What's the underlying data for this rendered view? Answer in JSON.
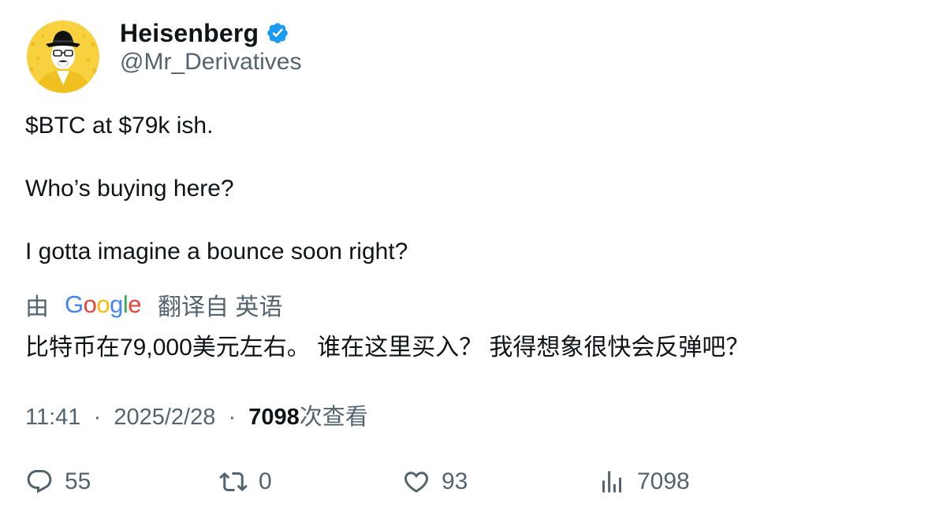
{
  "author": {
    "display_name": "Heisenberg",
    "handle": "@Mr_Derivatives",
    "verified": true,
    "avatar": "heisenberg-cartoon-avatar"
  },
  "tweet": {
    "lines": [
      "$BTC at $79k ish.",
      "Who’s buying here?",
      "I gotta imagine a bounce soon right?"
    ]
  },
  "translation": {
    "prefix": "由",
    "provider": "Google",
    "label": "翻译自 英语",
    "text": "比特币在79,000美元左右。 谁在这里买入？ 我得想象很快会反弹吧？"
  },
  "meta": {
    "time": "11:41",
    "separator": "·",
    "date": "2025/2/28",
    "views_count": "7098",
    "views_label": "次查看"
  },
  "actions": {
    "replies": "55",
    "retweets": "0",
    "likes": "93",
    "views": "7098"
  },
  "colors": {
    "text": "#0f1419",
    "secondary": "#536471",
    "verified": "#1d9bf0",
    "avatar_bg": "#f5c518"
  }
}
